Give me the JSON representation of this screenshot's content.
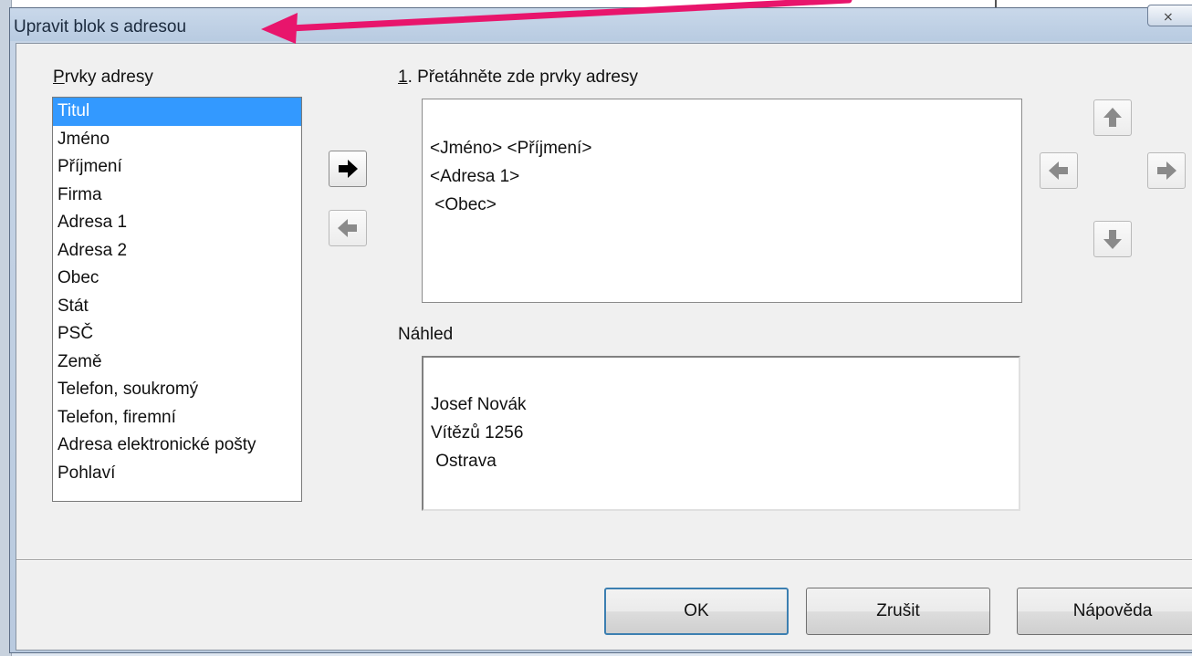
{
  "window": {
    "title": "Upravit blok s adresou",
    "close_symbol": "⨯"
  },
  "elements_label": {
    "prefix": "",
    "accel": "P",
    "rest": "rvky adresy"
  },
  "elements_list": [
    "Titul",
    "Jméno",
    "Příjmení",
    "Firma",
    "Adresa 1",
    "Adresa 2",
    "Obec",
    "Stát",
    "PSČ",
    "Země",
    "Telefon, soukromý",
    "Telefon, firemní",
    "Adresa elektronické pošty",
    "Pohlaví"
  ],
  "selected_index": 0,
  "drag_label": {
    "accel": "1",
    "rest": ". Přetáhněte zde prvky adresy"
  },
  "address_block": [
    "<Jméno> <Příjmení>",
    "<Adresa 1>",
    " <Obec>"
  ],
  "preview_label": "Náhled",
  "preview": [
    "Josef Novák",
    "Vítězů 1256",
    " Ostrava"
  ],
  "buttons": {
    "ok": "OK",
    "cancel": "Zrušit",
    "help": "Nápověda"
  },
  "icons": {
    "add": "arrow-right-icon",
    "remove": "arrow-left-icon",
    "up": "arrow-up-icon",
    "down": "arrow-down-icon",
    "left": "arrow-left-icon",
    "right": "arrow-right-icon"
  },
  "colors": {
    "selection": "#3399ff",
    "annotation": "#e8156c"
  }
}
